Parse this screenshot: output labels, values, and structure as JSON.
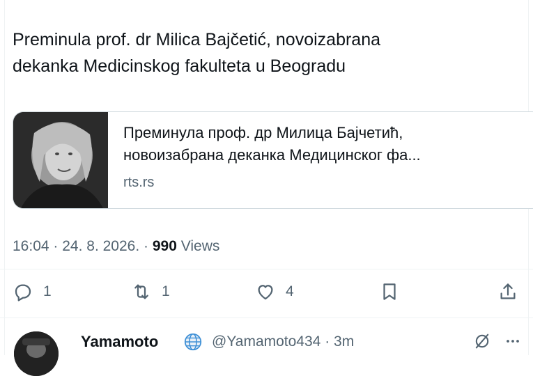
{
  "tweet": {
    "text_line1": "Preminula prof. dr Milica Bajčetić, novoizabrana",
    "text_line2": "dekanka Medicinskog fakulteta u Beogradu",
    "card": {
      "title_line1": "Преминула проф. др Милица Бајчетић,",
      "title_line2": "новоизабрана деканка Медицинског фа...",
      "domain": "rts.rs"
    },
    "meta": {
      "time": "16:04",
      "date": "24. 8. 2026.",
      "views_count": "990",
      "views_label": "Views"
    },
    "actions": {
      "reply_count": "1",
      "retweet_count": "1",
      "like_count": "4"
    }
  },
  "reply": {
    "name": "Yamamoto",
    "handle": "@Yamamoto434",
    "time": "3m"
  },
  "icons": {
    "reply": "reply-icon",
    "retweet": "retweet-icon",
    "like": "heart-icon",
    "bookmark": "bookmark-icon",
    "share": "share-icon",
    "globe": "globe-icon",
    "grok": "grok-icon",
    "more": "more-icon"
  }
}
